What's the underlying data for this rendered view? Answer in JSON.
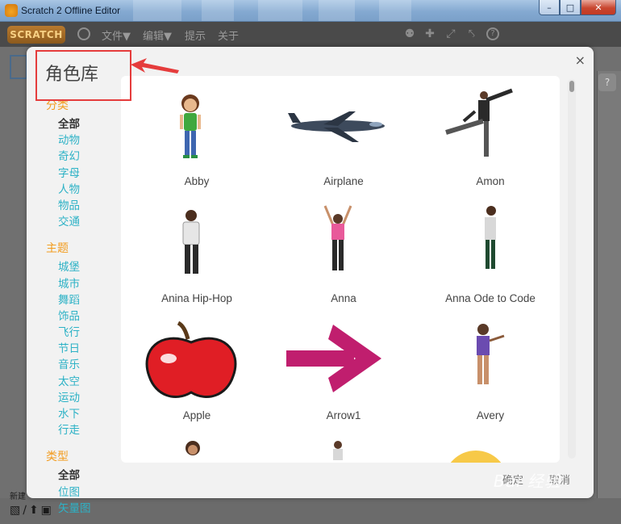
{
  "window": {
    "title": "Scratch 2 Offline Editor"
  },
  "menubar": {
    "logo": "SCRATCH",
    "items": [
      "文件▼",
      "编辑▼",
      "提示",
      "关于"
    ]
  },
  "background": {
    "new_label": "新建",
    "help_glyph": "?"
  },
  "dialog": {
    "title": "角色库",
    "close_glyph": "×",
    "sections": [
      {
        "heading": "分类",
        "items": [
          "全部",
          "动物",
          "奇幻",
          "字母",
          "人物",
          "物品",
          "交通"
        ],
        "active": "全部"
      },
      {
        "heading": "主题",
        "items": [
          "城堡",
          "城市",
          "舞蹈",
          "饰品",
          "飞行",
          "节日",
          "音乐",
          "太空",
          "运动",
          "水下",
          "行走"
        ],
        "active": ""
      },
      {
        "heading": "类型",
        "items": [
          "全部",
          "位图",
          "矢量图"
        ],
        "active": "全部"
      }
    ],
    "sprites": [
      "Abby",
      "Airplane",
      "Amon",
      "Anina Hip-Hop",
      "Anna",
      "Anna Ode to Code",
      "Apple",
      "Arrow1",
      "Avery"
    ],
    "ok_label": "确定",
    "cancel_label": "取消"
  },
  "watermark": "Bai 经验"
}
